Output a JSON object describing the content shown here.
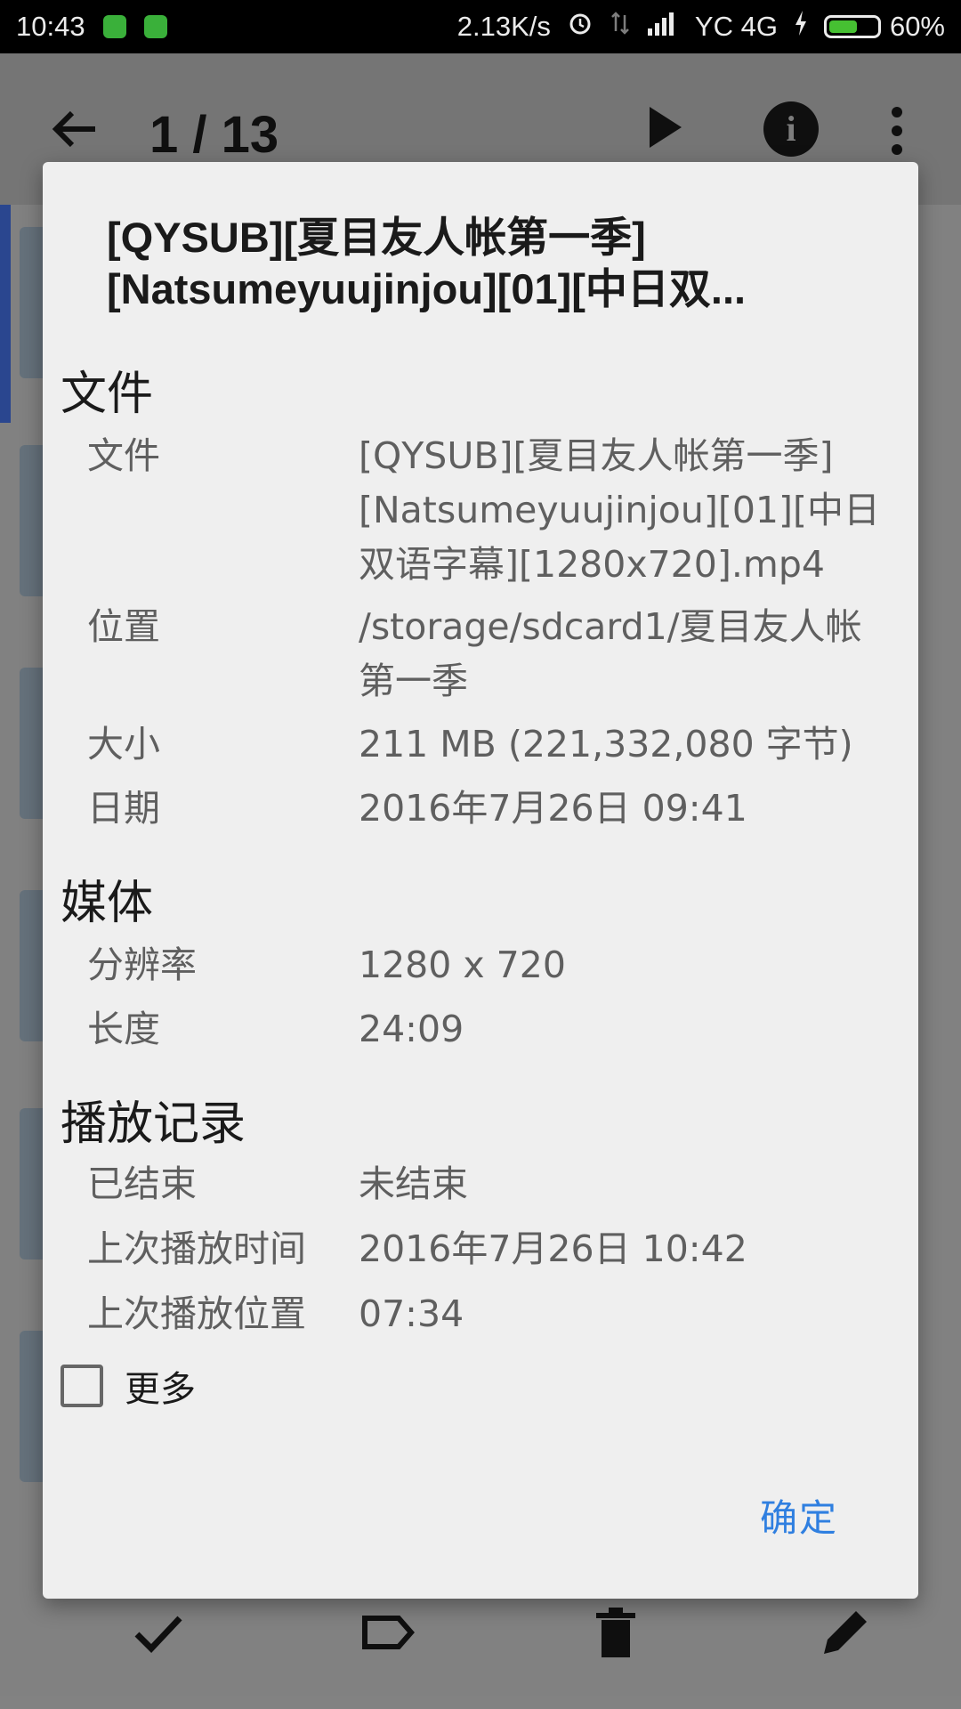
{
  "status_bar": {
    "time": "10:43",
    "net_speed": "2.13K/s",
    "carrier": "YC 4G",
    "battery": "60%",
    "battery_level": 0.6
  },
  "app_bar": {
    "counter": "1 / 13"
  },
  "dialog": {
    "title_lines": [
      "[QYSUB][夏目友人帐第一季]",
      "[Natsumeyuujinjou][01][中日双..."
    ],
    "sections": {
      "file": {
        "header": "文件",
        "name_key": "文件",
        "name_lines": [
          "[QYSUB][夏目友人帐第一季]",
          "[Natsumeyuujinjou][01][中日",
          "双语字幕][1280x720].mp4"
        ],
        "location_key": "位置",
        "location_lines": [
          "/storage/sdcard1/夏目友人帐",
          "第一季"
        ],
        "size_key": "大小",
        "size_value": "211 MB (221,332,080 字节)",
        "date_key": "日期",
        "date_value": "2016年7月26日 09:41"
      },
      "media": {
        "header": "媒体",
        "resolution_key": "分辨率",
        "resolution_value": "1280 x 720",
        "duration_key": "长度",
        "duration_value": "24:09"
      },
      "history": {
        "header": "播放记录",
        "finished_key": "已结束",
        "finished_value": "未结束",
        "last_time_key": "上次播放时间",
        "last_time_value": "2016年7月26日 10:42",
        "last_pos_key": "上次播放位置",
        "last_pos_value": "07:34"
      }
    },
    "more_label": "更多",
    "ok_label": "确定"
  },
  "colors": {
    "accent": "#2f7fe0",
    "dialog_bg": "#efefef"
  }
}
